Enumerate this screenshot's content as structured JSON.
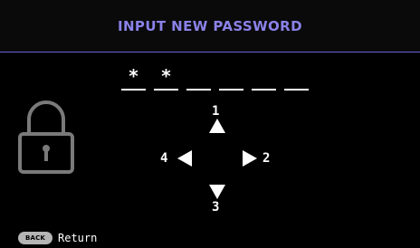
{
  "header": {
    "title": "INPUT NEW PASSWORD",
    "accent_color": "#8a82e8"
  },
  "password": {
    "slot_count": 6,
    "entered": [
      "*",
      "*",
      "",
      "",
      "",
      ""
    ]
  },
  "lock": {
    "icon": "padlock-icon",
    "color": "#7a7a7a"
  },
  "keypad": {
    "up": {
      "label": "1",
      "icon": "arrow-up-icon"
    },
    "right": {
      "label": "2",
      "icon": "arrow-right-icon"
    },
    "down": {
      "label": "3",
      "icon": "arrow-down-icon"
    },
    "left": {
      "label": "4",
      "icon": "arrow-left-icon"
    }
  },
  "footer": {
    "back_key": "BACK",
    "action_label": "Return"
  }
}
